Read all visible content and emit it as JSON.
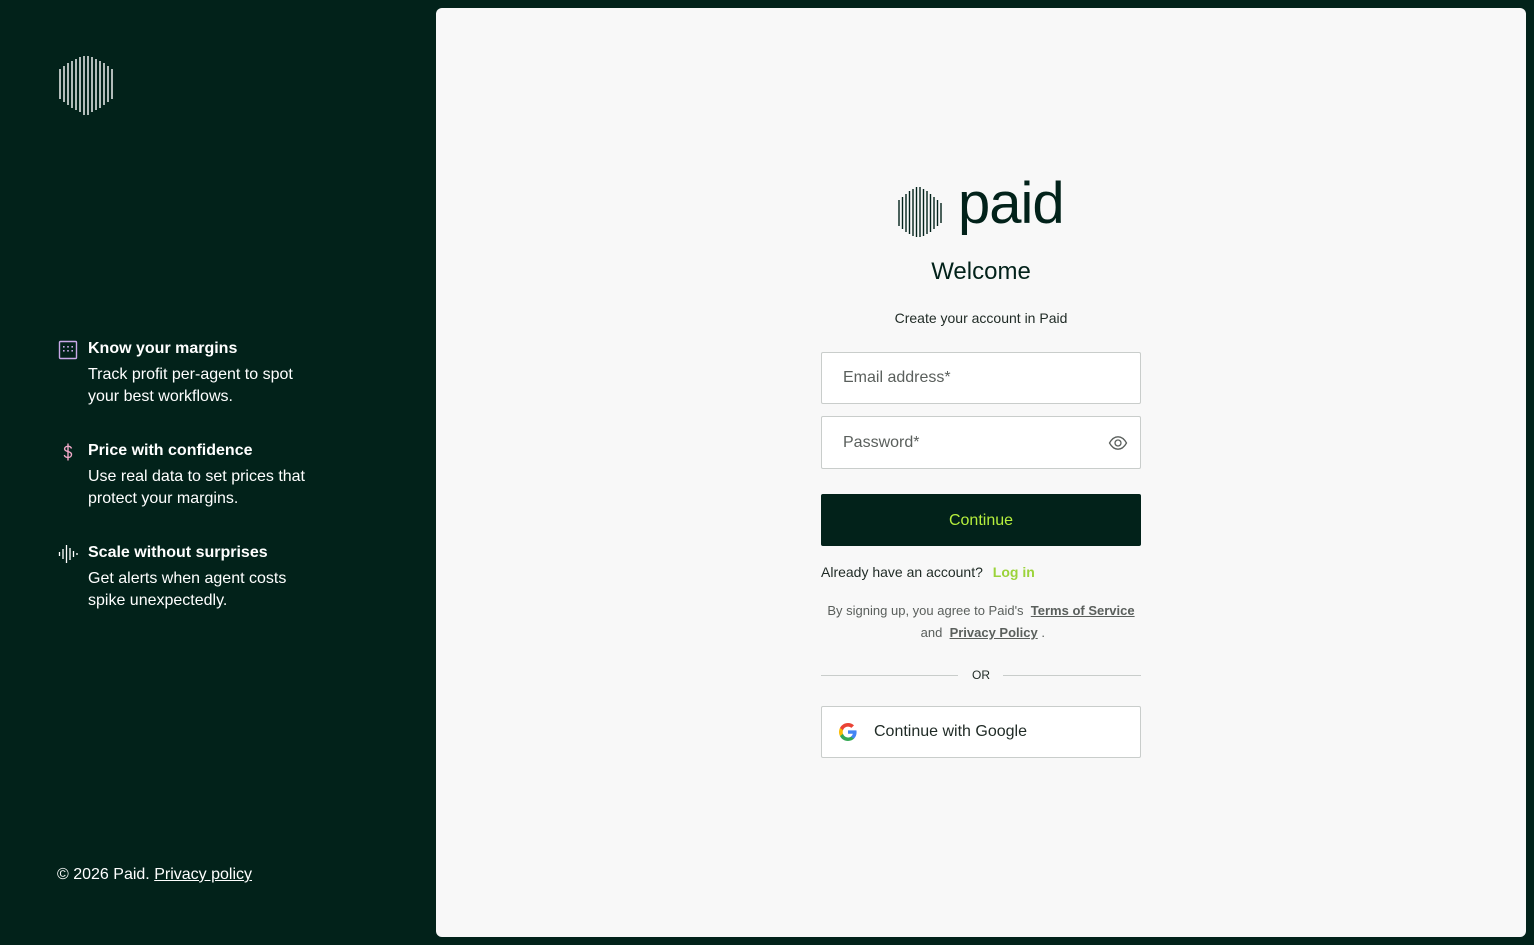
{
  "sidebar": {
    "features": [
      {
        "icon": "grid-calendar-icon",
        "title": "Know your margins",
        "description": "Track profit per-agent to spot your best workflows."
      },
      {
        "icon": "dollar-sign-icon",
        "title": "Price with confidence",
        "description": "Use real data to set prices that protect your margins."
      },
      {
        "icon": "audio-wave-icon",
        "title": "Scale without surprises",
        "description": "Get alerts when agent costs spike unexpectedly."
      }
    ],
    "footer_copyright": "© 2026 Paid.",
    "footer_privacy_link": "Privacy policy"
  },
  "form": {
    "brand_name": "paid",
    "welcome": "Welcome",
    "subtitle": "Create your account in Paid",
    "email_placeholder": "Email address*",
    "password_placeholder": "Password*",
    "continue_label": "Continue",
    "have_account_text": "Already have an account?",
    "login_link": "Log in",
    "terms_prefix": "By signing up, you agree to Paid's",
    "terms_of_service": "Terms of Service",
    "terms_and": "and",
    "privacy_policy": "Privacy Policy",
    "terms_suffix": ".",
    "or_text": "OR",
    "google_label": "Continue with Google"
  },
  "colors": {
    "dark_green": "#02221a",
    "accent_lime": "#b6ef3d",
    "link_lime": "#9bd33a",
    "icon_lavender": "#c9a9e8",
    "icon_pink": "#f0a8c8"
  }
}
